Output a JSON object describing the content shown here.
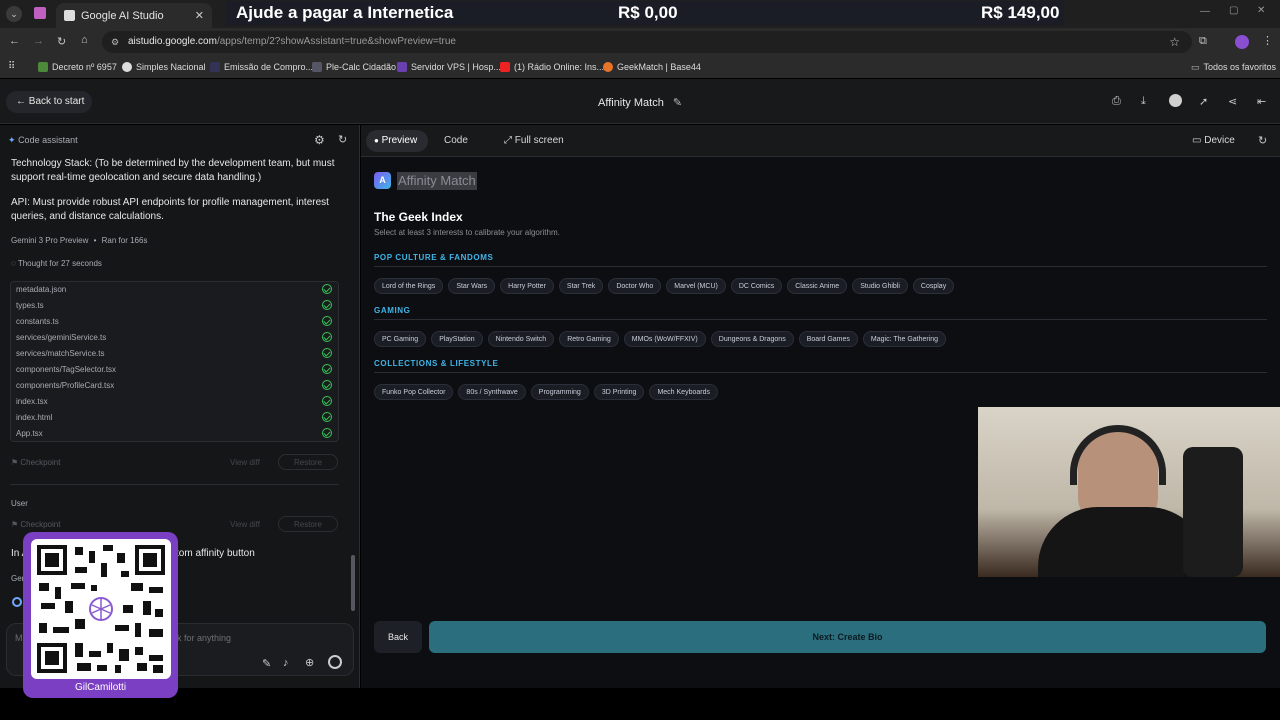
{
  "browser": {
    "tab_title": "Google AI Studio",
    "url_domain": "aistudio.google.com",
    "url_path": "/apps/temp/2?showAssistant=true&showPreview=true",
    "bookmarks": [
      "Decreto nº 6957",
      "Simples Nacional",
      "Emissão de Compro...",
      "Ple-Calc Cidadão",
      "Servidor VPS | Hosp...",
      "(1) Rádio Online: Ins...",
      "GeekMatch | Base44"
    ],
    "all_bookmarks": "Todos os favoritos"
  },
  "overlay_banner": {
    "text": "Ajude a pagar a Internetica",
    "amount_current": "R$ 0,00",
    "amount_goal": "R$ 149,00"
  },
  "app_header": {
    "back_label": "Back to start",
    "title": "Affinity Match"
  },
  "assistant": {
    "header": "Code assistant",
    "para1": "Technology Stack: (To be determined by the development team, but must support real-time geolocation and secure data handling.)",
    "para2": "API: Must provide robust API endpoints for profile management, interest queries, and distance calculations.",
    "model": "Gemini 3 Pro Preview",
    "ran_for": "Ran for 166s",
    "thought": "Thought for 27 seconds",
    "files": [
      "metadata.json",
      "types.ts",
      "constants.ts",
      "services/geminiService.ts",
      "services/matchService.ts",
      "components/TagSelector.tsx",
      "components/ProfileCard.tsx",
      "index.tsx",
      "index.html",
      "App.tsx"
    ],
    "checkpoint": "Checkpoint",
    "view_diff": "View diff",
    "restore": "Restore",
    "user_label": "User",
    "user_msg_start": "In A",
    "user_msg_end": "tom affinity button",
    "gen_label": "Gen",
    "input_start": "M",
    "input_placeholder_end": "k for anything"
  },
  "preview": {
    "tab_preview": "Preview",
    "tab_code": "Code",
    "tab_fullscreen": "Full screen",
    "device": "Device",
    "app_logo_letter": "A",
    "app_name": "Affinity Match",
    "page_title": "The Geek Index",
    "page_subtitle": "Select at least 3 interests to calibrate your algorithm.",
    "sections": [
      {
        "title": "POP CULTURE & FANDOMS",
        "tags": [
          "Lord of the Rings",
          "Star Wars",
          "Harry Potter",
          "Star Trek",
          "Doctor Who",
          "Marvel (MCU)",
          "DC Comics",
          "Classic Anime",
          "Studio Ghibli",
          "Cosplay"
        ]
      },
      {
        "title": "GAMING",
        "tags": [
          "PC Gaming",
          "PlayStation",
          "Nintendo Switch",
          "Retro Gaming",
          "MMOs (WoW/FFXIV)",
          "Dungeons & Dragons",
          "Board Games",
          "Magic: The Gathering"
        ]
      },
      {
        "title": "COLLECTIONS & LIFESTYLE",
        "tags": [
          "Funko Pop Collector",
          "80s / Synthwave",
          "Programming",
          "3D Printing",
          "Mech Keyboards"
        ]
      }
    ],
    "back_button": "Back",
    "next_button": "Next: Create Bio"
  },
  "qr_overlay": {
    "name": "GilCamilotti"
  },
  "colors": {
    "accent": "#3fb5e8",
    "next_button": "#2b6f7e",
    "qr_bg": "#7a3fc2",
    "logo": "#7c5cf0"
  }
}
